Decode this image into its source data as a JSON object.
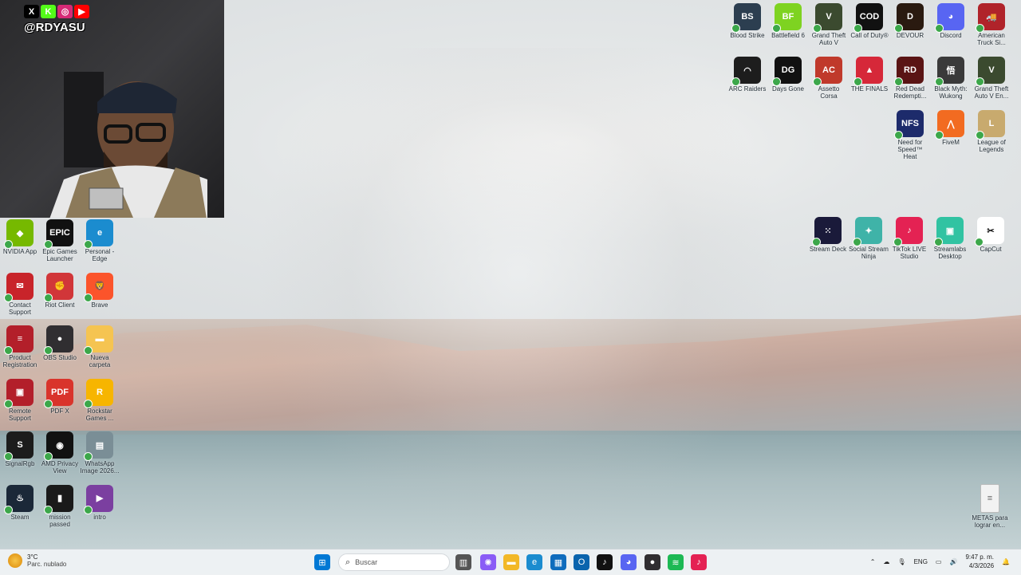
{
  "webcam": {
    "handle": "@RDYASU",
    "socials": [
      {
        "icon": "x-icon",
        "glyph": "X",
        "color": "#000000"
      },
      {
        "icon": "kick-icon",
        "glyph": "K",
        "color": "#53fc18"
      },
      {
        "icon": "instagram-icon",
        "glyph": "◎",
        "color": "#d62976"
      },
      {
        "icon": "youtube-icon",
        "glyph": "▶",
        "color": "#ff0000"
      }
    ]
  },
  "desktop_left": [
    {
      "label": "NVIDIA App",
      "icon": "nvidia-icon",
      "color": "#76b900",
      "glyph": "◆"
    },
    {
      "label": "Epic Games Launcher",
      "icon": "epic-games-icon",
      "color": "#111111",
      "glyph": "EPIC"
    },
    {
      "label": "Personal - Edge",
      "icon": "edge-icon",
      "color": "#1b8ccf",
      "glyph": "e"
    },
    {
      "label": "Contact Support",
      "icon": "contact-support-icon",
      "color": "#c8242a",
      "glyph": "✉"
    },
    {
      "label": "Riot Client",
      "icon": "riot-client-icon",
      "color": "#d13639",
      "glyph": "✊"
    },
    {
      "label": "Brave",
      "icon": "brave-icon",
      "color": "#fb542b",
      "glyph": "🦁"
    },
    {
      "label": "Product Registration",
      "icon": "product-registration-icon",
      "color": "#b31f2a",
      "glyph": "≡"
    },
    {
      "label": "OBS Studio",
      "icon": "obs-icon",
      "color": "#302e31",
      "glyph": "●"
    },
    {
      "label": "Nueva carpeta",
      "icon": "folder-icon",
      "color": "#f5c451",
      "glyph": "▬"
    },
    {
      "label": "Remote Support",
      "icon": "remote-support-icon",
      "color": "#b31f2a",
      "glyph": "▣"
    },
    {
      "label": "PDF X",
      "icon": "pdf-x-icon",
      "color": "#d9342b",
      "glyph": "PDF"
    },
    {
      "label": "Rockstar Games ...",
      "icon": "rockstar-icon",
      "color": "#f7b500",
      "glyph": "R"
    },
    {
      "label": "SignalRgb",
      "icon": "signalrgb-icon",
      "color": "#1c1c1c",
      "glyph": "S"
    },
    {
      "label": "AMD Privacy View",
      "icon": "amd-privacy-icon",
      "color": "#111111",
      "glyph": "◉"
    },
    {
      "label": "WhatsApp Image 2026...",
      "icon": "image-file-icon",
      "color": "#7a8e96",
      "glyph": "▤"
    },
    {
      "label": "Steam",
      "icon": "steam-icon",
      "color": "#1b2838",
      "glyph": "♨"
    },
    {
      "label": "mission passed",
      "icon": "video-file-icon",
      "color": "#1a1a1a",
      "glyph": "▮"
    },
    {
      "label": "intro",
      "icon": "video-clip-icon",
      "color": "#7b3fa0",
      "glyph": "▶"
    }
  ],
  "desktop_right_top": [
    {
      "label": "Blood Strike",
      "icon": "blood-strike-icon",
      "color": "#2c3e50",
      "glyph": "BS"
    },
    {
      "label": "Battlefield 6",
      "icon": "battlefield-icon",
      "color": "#7ed321",
      "glyph": "BF"
    },
    {
      "label": "Grand Theft Auto V",
      "icon": "gta-v-icon",
      "color": "#3b4a2f",
      "glyph": "V"
    },
    {
      "label": "Call of Duty®",
      "icon": "call-of-duty-icon",
      "color": "#111111",
      "glyph": "COD"
    },
    {
      "label": "DEVOUR",
      "icon": "devour-icon",
      "color": "#2a1a10",
      "glyph": "D"
    },
    {
      "label": "Discord",
      "icon": "discord-icon",
      "color": "#5865f2",
      "glyph": "◕"
    },
    {
      "label": "American Truck Si...",
      "icon": "american-truck-icon",
      "color": "#b0232a",
      "glyph": "🚚"
    },
    {
      "label": "ARC Raiders",
      "icon": "arc-raiders-icon",
      "color": "#1d1d1d",
      "glyph": "◠"
    },
    {
      "label": "Days Gone",
      "icon": "days-gone-icon",
      "color": "#111111",
      "glyph": "DG"
    },
    {
      "label": "Assetto Corsa",
      "icon": "assetto-corsa-icon",
      "color": "#c0392b",
      "glyph": "AC"
    },
    {
      "label": "THE FINALS",
      "icon": "the-finals-icon",
      "color": "#d62839",
      "glyph": "▲"
    },
    {
      "label": "Red Dead Redempti...",
      "icon": "red-dead-icon",
      "color": "#5a1414",
      "glyph": "RD"
    },
    {
      "label": "Black Myth: Wukong",
      "icon": "black-myth-icon",
      "color": "#3a3a3a",
      "glyph": "悟"
    },
    {
      "label": "Grand Theft Auto V En...",
      "icon": "gta-v-enhanced-icon",
      "color": "#3b4a2f",
      "glyph": "V"
    },
    {
      "label": "Need for Speed™ Heat",
      "icon": "nfs-heat-icon",
      "color": "#1d2b6b",
      "glyph": "NFS"
    },
    {
      "label": "FiveM",
      "icon": "fivem-icon",
      "color": "#f26b21",
      "glyph": "⋀"
    },
    {
      "label": "League of Legends",
      "icon": "league-of-legends-icon",
      "color": "#c8aa6e",
      "glyph": "L"
    }
  ],
  "desktop_right_mid": [
    {
      "label": "Stream Deck",
      "icon": "stream-deck-icon",
      "color": "#1a1a3a",
      "glyph": "⁙"
    },
    {
      "label": "Social Stream Ninja",
      "icon": "social-stream-ninja-icon",
      "color": "#3fb3a8",
      "glyph": "✦"
    },
    {
      "label": "TikTok LIVE Studio",
      "icon": "tiktok-live-studio-icon",
      "color": "#e42253",
      "glyph": "♪"
    },
    {
      "label": "Streamlabs Desktop",
      "icon": "streamlabs-icon",
      "color": "#31c3a2",
      "glyph": "▣"
    },
    {
      "label": "CapCut",
      "icon": "capcut-icon",
      "color": "#ffffff",
      "glyph": "✂"
    }
  ],
  "desktop_right_bottom": {
    "label": "METAS para lograr en...",
    "icon": "text-file-icon",
    "color": "#f2f2f2",
    "glyph": "≡"
  },
  "taskbar": {
    "weather_temp": "3°C",
    "weather_desc": "Parc. nublado",
    "search_placeholder": "Buscar",
    "apps": [
      {
        "icon": "windows-start-icon",
        "color": "#0078d4",
        "glyph": "⊞"
      },
      {
        "icon": "task-view-icon",
        "color": "#555555",
        "glyph": "▥"
      },
      {
        "icon": "copilot-icon",
        "color": "#8a5cf6",
        "glyph": "✺"
      },
      {
        "icon": "file-explorer-icon",
        "color": "#f2b827",
        "glyph": "▬"
      },
      {
        "icon": "edge-taskbar-icon",
        "color": "#1b8ccf",
        "glyph": "e"
      },
      {
        "icon": "store-icon",
        "color": "#0f6cbd",
        "glyph": "▦"
      },
      {
        "icon": "outlook-icon",
        "color": "#0a64ad",
        "glyph": "O"
      },
      {
        "icon": "tiktok-taskbar-icon",
        "color": "#111111",
        "glyph": "♪"
      },
      {
        "icon": "discord-taskbar-icon",
        "color": "#5865f2",
        "glyph": "◕"
      },
      {
        "icon": "obs-taskbar-icon",
        "color": "#302e31",
        "glyph": "●"
      },
      {
        "icon": "spotify-icon",
        "color": "#1db954",
        "glyph": "≋"
      },
      {
        "icon": "tiktok-live-taskbar-icon",
        "color": "#e42253",
        "glyph": "♪"
      }
    ],
    "language": "ENG",
    "time": "9:47 p. m.",
    "date": "4/3/2026"
  }
}
